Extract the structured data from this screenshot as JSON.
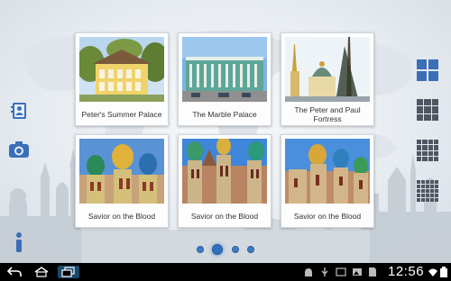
{
  "landmarks": [
    {
      "caption": "Peter's Summer Palace"
    },
    {
      "caption": "The Marble Palace"
    },
    {
      "caption": "The Peter and Paul Fortress"
    },
    {
      "caption": "Savior on the Blood"
    },
    {
      "caption": "Savior on the Blood"
    },
    {
      "caption": "Savior on the Blood"
    }
  ],
  "left_tools": [
    "address-card-icon",
    "camera-icon",
    "info-icon"
  ],
  "grid_layouts": [
    "grid-2x2-icon",
    "grid-3x3-icon",
    "grid-4x4-icon",
    "grid-5x5-icon"
  ],
  "pager": {
    "pages": 4,
    "current": 2
  },
  "status_bar": {
    "clock": "12:56",
    "icons": [
      "back-icon",
      "home-icon",
      "recent-apps-icon",
      "android-debug-icon",
      "usb-icon",
      "screenshot-icon",
      "gallery-icon",
      "sd-card-icon",
      "wifi-icon",
      "battery-icon"
    ]
  },
  "colors": {
    "accent": "#3a6fb8",
    "background": "#e9edf1",
    "system_bar": "#000000"
  }
}
